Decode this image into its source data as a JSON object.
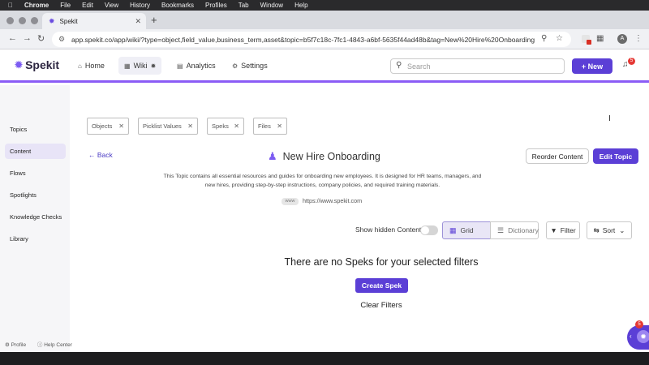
{
  "menubar": {
    "app": "Chrome",
    "items": [
      "File",
      "Edit",
      "View",
      "History",
      "Bookmarks",
      "Profiles",
      "Tab",
      "Window",
      "Help"
    ]
  },
  "browser": {
    "tab_title": "Spekit",
    "url": "app.spekit.co/app/wiki/?type=object,field_value,business_term,asset&topic=b5f7c18c-7fc1-4843-a6bf-5635f44ad48b&tag=New%20Hire%20Onboarding",
    "profile_initial": "A"
  },
  "app": {
    "logo_text": "Spekit",
    "nav": [
      "Home",
      "Wiki",
      "Analytics",
      "Settings"
    ],
    "search_placeholder": "Search",
    "new_label": "+ New",
    "notif_count": "5"
  },
  "sidebar": {
    "items": [
      "Topics",
      "Content",
      "Flows",
      "Spotlights",
      "Knowledge Checks",
      "Library"
    ],
    "footer_profile": "Profile",
    "footer_help": "Help Center"
  },
  "filters": {
    "chips": [
      "Objects",
      "Picklist Values",
      "Speks",
      "Files"
    ]
  },
  "topic": {
    "back_label": "Back",
    "title": "New Hire Onboarding",
    "reorder_label": "Reorder Content",
    "edit_label": "Edit Topic",
    "description": "This Topic contains all essential resources and guides for onboarding new employees. It is designed for HR teams, managers, and new hires, providing step-by-step instructions, company policies, and required training materials.",
    "link_badge": "www",
    "link_url": "https://www.spekit.com"
  },
  "controls": {
    "show_hidden_label": "Show hidden Content",
    "grid_label": "Grid",
    "dictionary_label": "Dictionary",
    "filter_label": "Filter",
    "sort_label": "Sort"
  },
  "empty_state": {
    "message": "There are no Speks for your selected filters",
    "create_label": "Create Spek",
    "clear_label": "Clear Filters"
  },
  "widget": {
    "badge": "5"
  },
  "colors": {
    "accent": "#5b3fd6",
    "accent_light": "#8b5cf6"
  }
}
